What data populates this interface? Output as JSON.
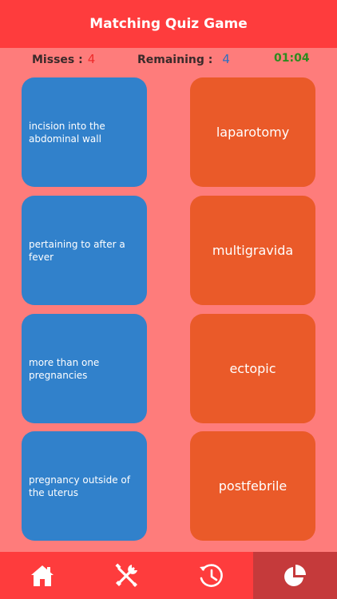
{
  "app": {
    "title": "Matching Quiz Game"
  },
  "stats": {
    "misses_label": "Misses :",
    "misses_value": "4",
    "remaining_label": "Remaining :",
    "remaining_value": "4",
    "timer": "01:04"
  },
  "definitions": [
    "incision into the abdominal wall",
    "pertaining to after a fever",
    "more than one pregnancies",
    "pregnancy outside of the uterus"
  ],
  "terms": [
    "laparotomy",
    "multigravida",
    "ectopic",
    "postfebrile"
  ],
  "tabs": [
    {
      "icon": "home-icon"
    },
    {
      "icon": "tools-icon"
    },
    {
      "icon": "history-icon"
    },
    {
      "icon": "pie-chart-icon",
      "active": true
    }
  ],
  "colors": {
    "header": "#fe3c3d",
    "background": "#fe7c7b",
    "definition_card": "#3181cb",
    "term_card": "#ea5a29",
    "active_tab": "#c53a3b",
    "timer": "#2e8b1e"
  }
}
